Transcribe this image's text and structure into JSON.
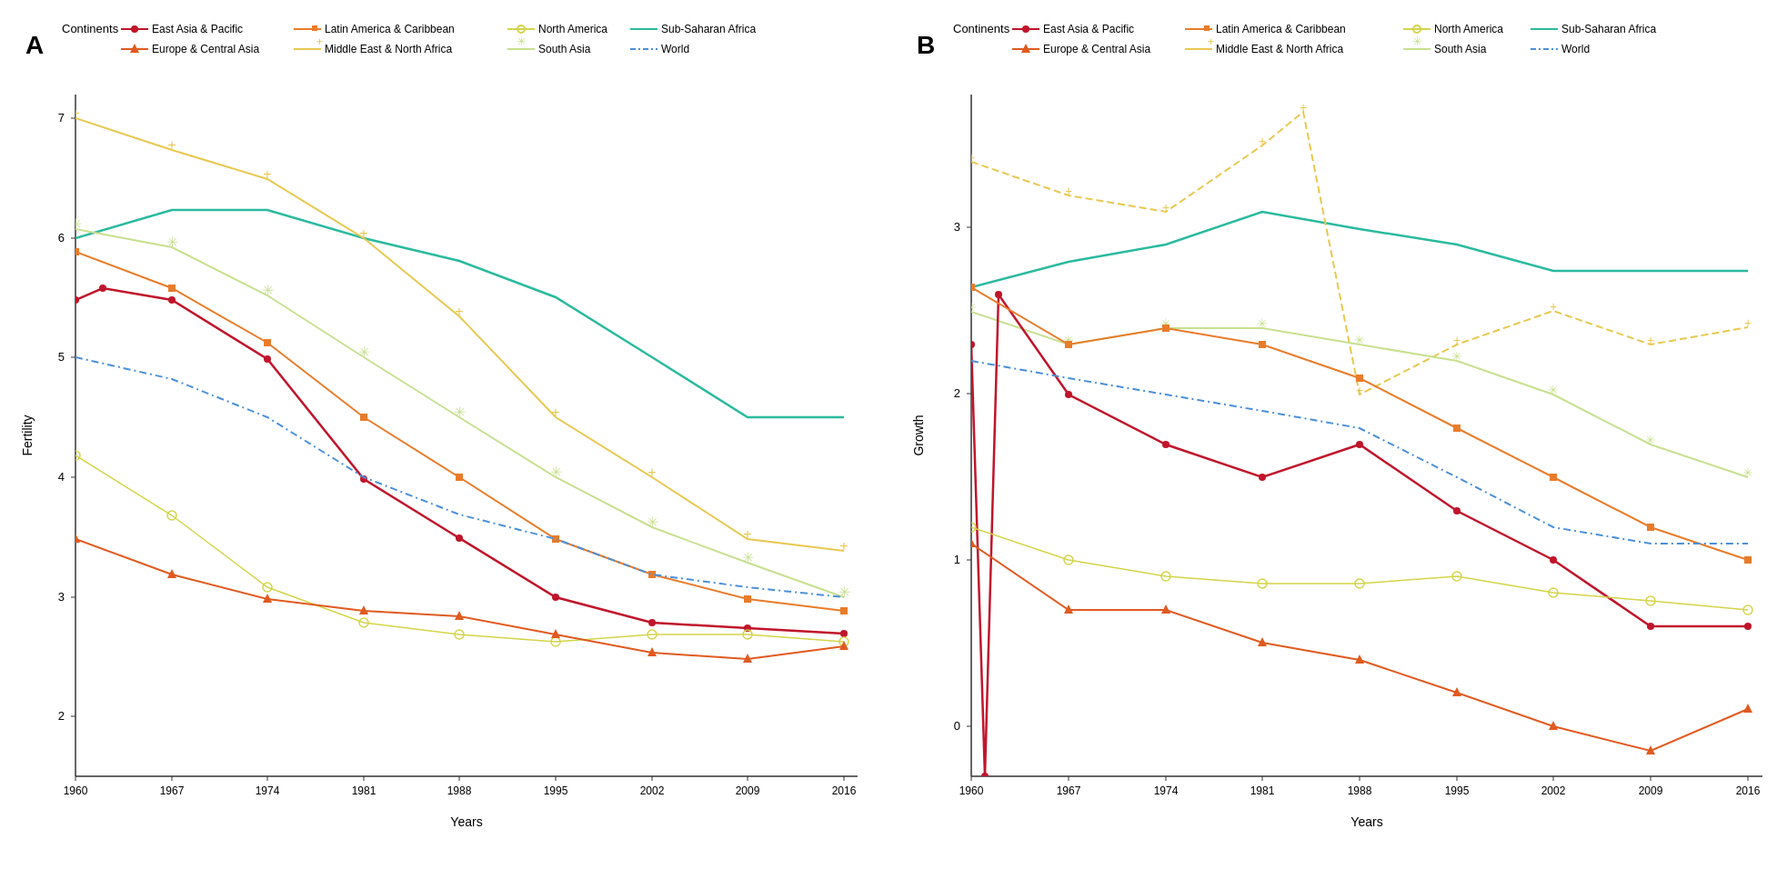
{
  "charts": [
    {
      "id": "chart-a",
      "label": "A",
      "title": "Fertility",
      "x_axis_label": "Years",
      "y_axis_label": "Fertility",
      "x_ticks": [
        "1960",
        "1967",
        "1974",
        "1981",
        "1988",
        "1995",
        "2002",
        "2009",
        "2016"
      ],
      "y_ticks": [
        "2",
        "3",
        "4",
        "5",
        "6",
        "7"
      ],
      "y_min": 1.5,
      "y_max": 7.2
    },
    {
      "id": "chart-b",
      "label": "B",
      "title": "Growth",
      "x_axis_label": "Years",
      "y_axis_label": "Growth",
      "x_ticks": [
        "1960",
        "1967",
        "1974",
        "1981",
        "1988",
        "1995",
        "2002",
        "2009",
        "2016"
      ],
      "y_ticks": [
        "0",
        "1",
        "2",
        "3"
      ],
      "y_min": -0.3,
      "y_max": 3.8
    }
  ],
  "legend": {
    "title": "Continents",
    "items": [
      {
        "label": "East Asia & Pacific",
        "color": "#c0152b",
        "dash": "solid",
        "marker": "circle"
      },
      {
        "label": "Latin America & Caribbean",
        "color": "#e87c2a",
        "dash": "solid",
        "marker": "square"
      },
      {
        "label": "North America",
        "color": "#d4d44a",
        "dash": "solid",
        "marker": "circle-open"
      },
      {
        "label": "Sub-Saharan Africa",
        "color": "#2aba9e",
        "dash": "solid",
        "marker": "none"
      },
      {
        "label": "Europe & Central Asia",
        "color": "#e05a20",
        "dash": "solid",
        "marker": "triangle"
      },
      {
        "label": "Middle East & North Africa",
        "color": "#e8c850",
        "dash": "solid",
        "marker": "plus"
      },
      {
        "label": "South Asia",
        "color": "#c8e090",
        "dash": "solid",
        "marker": "star"
      },
      {
        "label": "World",
        "color": "#4a90d9",
        "dash": "dashdot",
        "marker": "none"
      }
    ]
  }
}
